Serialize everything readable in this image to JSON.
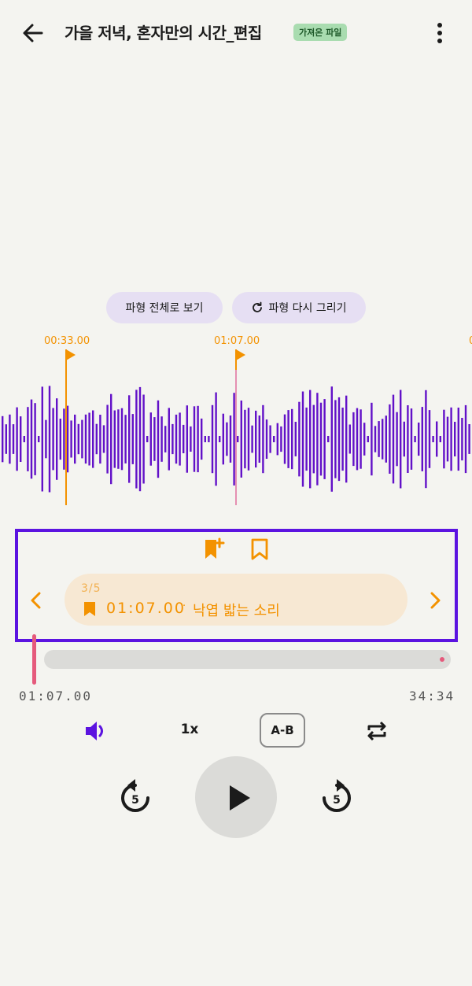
{
  "header": {
    "title": "가을 저녁, 혼자만의 시간_편집",
    "badge": "가져온 파일",
    "back_icon": "arrow-left-icon",
    "more_icon": "more-vertical-icon"
  },
  "waveform_actions": {
    "view_full": "파형 전체로 보기",
    "redraw": "파형 다시 그리기",
    "redraw_icon": "refresh-icon"
  },
  "markers": [
    {
      "time": "00:33.00"
    },
    {
      "time": "01:07.00"
    }
  ],
  "bookmark_panel": {
    "add_icon": "bookmark-add-icon",
    "list_icon": "bookmark-outline-icon",
    "count": "3/5",
    "time": "01:07.00",
    "separator": "·",
    "text": "낙엽 밟는 소리"
  },
  "progress": {
    "current": "01:07.00",
    "total": "34:34"
  },
  "controls": {
    "speed": "1x",
    "ab_repeat": "A-B",
    "rewind_seconds": "5",
    "forward_seconds": "5"
  },
  "colors": {
    "waveform": "#6211c8",
    "marker": "#f39200",
    "playhead": "#e55a7c",
    "accent_frame": "#5b13e0"
  }
}
